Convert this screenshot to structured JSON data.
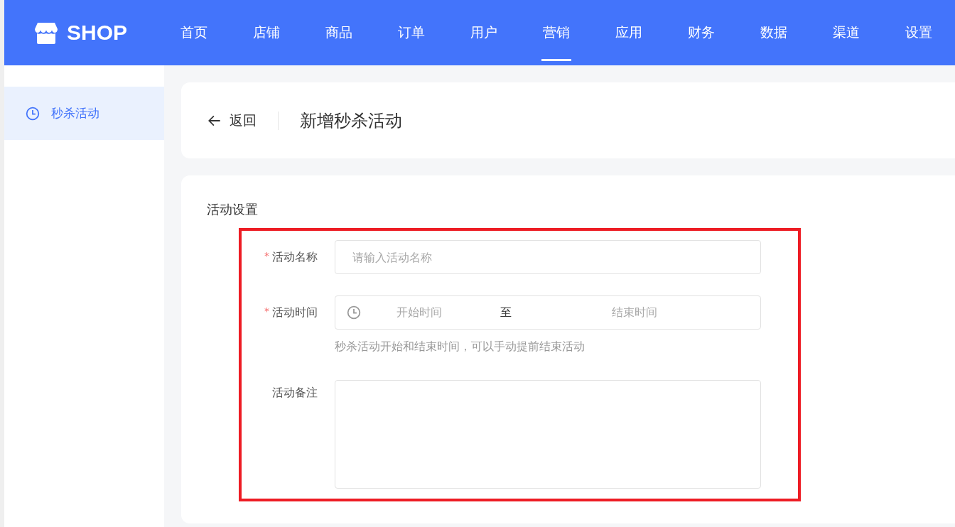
{
  "header": {
    "logo": "SHOP",
    "nav": [
      {
        "label": "首页",
        "selected": false
      },
      {
        "label": "店铺",
        "selected": false
      },
      {
        "label": "商品",
        "selected": false
      },
      {
        "label": "订单",
        "selected": false
      },
      {
        "label": "用户",
        "selected": false
      },
      {
        "label": "营销",
        "selected": true
      },
      {
        "label": "应用",
        "selected": false
      },
      {
        "label": "财务",
        "selected": false
      },
      {
        "label": "数据",
        "selected": false
      },
      {
        "label": "渠道",
        "selected": false
      },
      {
        "label": "设置",
        "selected": false
      }
    ]
  },
  "sidebar": {
    "items": [
      {
        "label": "秒杀活动",
        "selected": true
      }
    ]
  },
  "page_header": {
    "back": "返回",
    "title": "新增秒杀活动"
  },
  "form": {
    "section_title": "活动设置",
    "required_mark": "*",
    "fields": [
      {
        "kind": "text",
        "label": "活动名称",
        "required": true,
        "placeholder": "请输入活动名称"
      },
      {
        "kind": "daterange",
        "label": "活动时间",
        "required": true,
        "start_placeholder": "开始时间",
        "separator": "至",
        "end_placeholder": "结束时间",
        "help": "秒杀活动开始和结束时间，可以手动提前结束活动"
      },
      {
        "kind": "textarea",
        "label": "活动备注",
        "required": false
      }
    ]
  }
}
